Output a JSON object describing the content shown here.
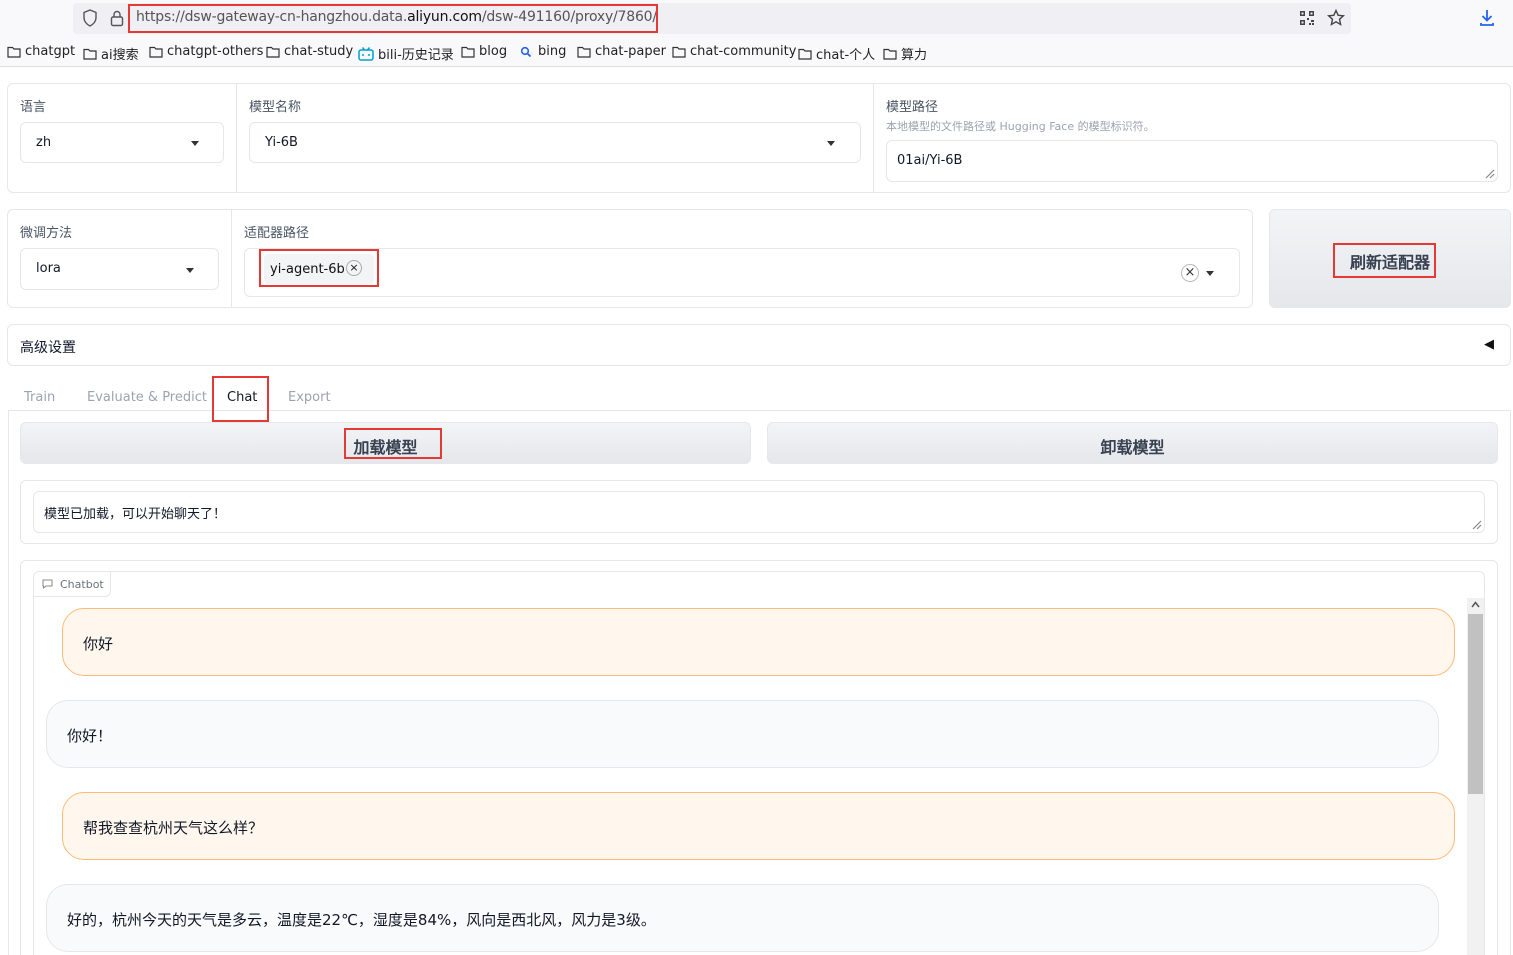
{
  "browser": {
    "url_prefix": "https://dsw-gateway-cn-hangzhou.data.",
    "url_host": "aliyun.com",
    "url_suffix": "/dsw-491160/proxy/7860/"
  },
  "bookmarks": [
    {
      "label": "chatgpt",
      "icon": "folder-icon"
    },
    {
      "label": "ai搜索",
      "icon": "folder-icon"
    },
    {
      "label": "chatgpt-others",
      "icon": "folder-icon"
    },
    {
      "label": "chat-study",
      "icon": "folder-icon"
    },
    {
      "label": "bili-历史记录",
      "icon": "bilibili-icon"
    },
    {
      "label": "blog",
      "icon": "folder-icon"
    },
    {
      "label": "bing",
      "icon": "search-icon"
    },
    {
      "label": "chat-paper",
      "icon": "folder-icon"
    },
    {
      "label": "chat-community",
      "icon": "folder-icon"
    },
    {
      "label": "chat-个人",
      "icon": "folder-icon"
    },
    {
      "label": "算力",
      "icon": "folder-icon"
    }
  ],
  "top": {
    "lang_label": "语言",
    "lang_value": "zh",
    "model_label": "模型名称",
    "model_value": "Yi-6B",
    "path_label": "模型路径",
    "path_hint": "本地模型的文件路径或 Hugging Face 的模型标识符。",
    "path_value": "01ai/Yi-6B"
  },
  "second": {
    "finetune_label": "微调方法",
    "finetune_value": "lora",
    "adapter_label": "适配器路径",
    "adapter_chip": "yi-agent-6b",
    "chip_remove": "×",
    "clear_all": "×",
    "refresh_label": "刷新适配器"
  },
  "advanced": {
    "label": "高级设置",
    "toggle": "◀"
  },
  "tabs": [
    "Train",
    "Evaluate & Predict",
    "Chat",
    "Export"
  ],
  "chat": {
    "load_label": "加载模型",
    "unload_label": "卸载模型",
    "status": "模型已加载，可以开始聊天了！",
    "chatbot_label": "Chatbot",
    "messages": [
      {
        "role": "user",
        "text": "你好"
      },
      {
        "role": "bot",
        "text": "你好！"
      },
      {
        "role": "user",
        "text": "帮我查查杭州天气这么样？"
      },
      {
        "role": "bot",
        "text": "好的，杭州今天的天气是多云，温度是22℃，湿度是84%，风向是西北风，风力是3级。"
      }
    ]
  },
  "colors": {
    "highlight": "#e53935",
    "user_bubble": "#fff7ed",
    "user_border": "#fdba74"
  }
}
